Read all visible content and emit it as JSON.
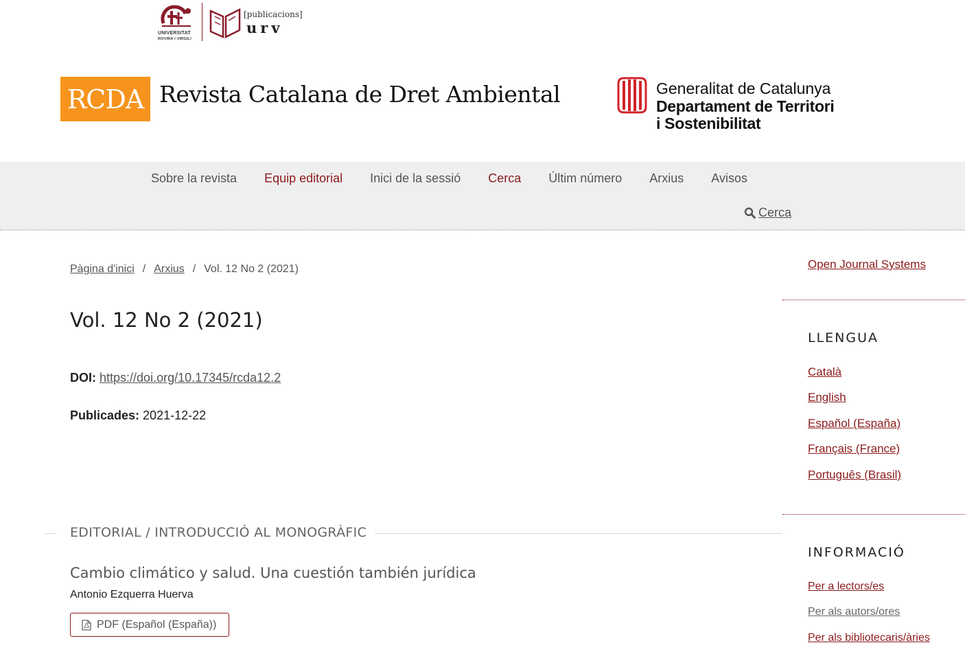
{
  "logos": {
    "urv_university_text_1": "UNIVERSITAT",
    "urv_university_text_2": "ROVIRA I VIRGILI",
    "publications_text": "[publicacions]",
    "urv_text": "urv",
    "journal_abbrev": "RCDA",
    "journal_name": "Revista Catalana de Dret Ambiental",
    "gencat_line1": "Generalitat de Catalunya",
    "gencat_line2": "Departament de Territori",
    "gencat_line3": "i Sostenibilitat"
  },
  "nav": {
    "items": [
      {
        "label": "Sobre la revista"
      },
      {
        "label": "Equip editorial"
      },
      {
        "label": "Inici de la sessió"
      },
      {
        "label": "Cerca"
      },
      {
        "label": "Últim número"
      },
      {
        "label": "Arxius"
      },
      {
        "label": "Avisos"
      }
    ],
    "search_label": "Cerca"
  },
  "breadcrumb": {
    "home": "Pàgina d'inici",
    "archives": "Arxius",
    "current": "Vol. 12 No 2 (2021)",
    "separator": "/"
  },
  "issue": {
    "title": "Vol. 12 No 2 (2021)",
    "doi_label": "DOI:",
    "doi_value": "https://doi.org/10.17345/rcda12.2",
    "published_label": "Publicades:",
    "published_value": "2021-12-22"
  },
  "section": {
    "title": "EDITORIAL / INTRODUCCIÓ AL MONOGRÀFIC",
    "article": {
      "title": "Cambio climático y salud. Una cuestión también jurídica",
      "author": "Antonio Ezquerra Huerva",
      "pdf_label": "PDF (Español (España))"
    }
  },
  "sidebar": {
    "ojs_link": "Open Journal Systems",
    "language_heading": "LLENGUA",
    "languages": [
      "Català",
      "English",
      "Español (España)",
      "Français (France)",
      "Português (Brasil)"
    ],
    "info_heading": "INFORMACIÓ",
    "info_links": [
      "Per a lectors/es",
      "Per als autors/ores",
      "Per als bibliotecaris/àries"
    ]
  },
  "colors": {
    "accent": "#8b1b1b",
    "rcda_orange": "#f7941d",
    "nav_bg": "#efefef",
    "gencat_red": "#d2232a"
  }
}
